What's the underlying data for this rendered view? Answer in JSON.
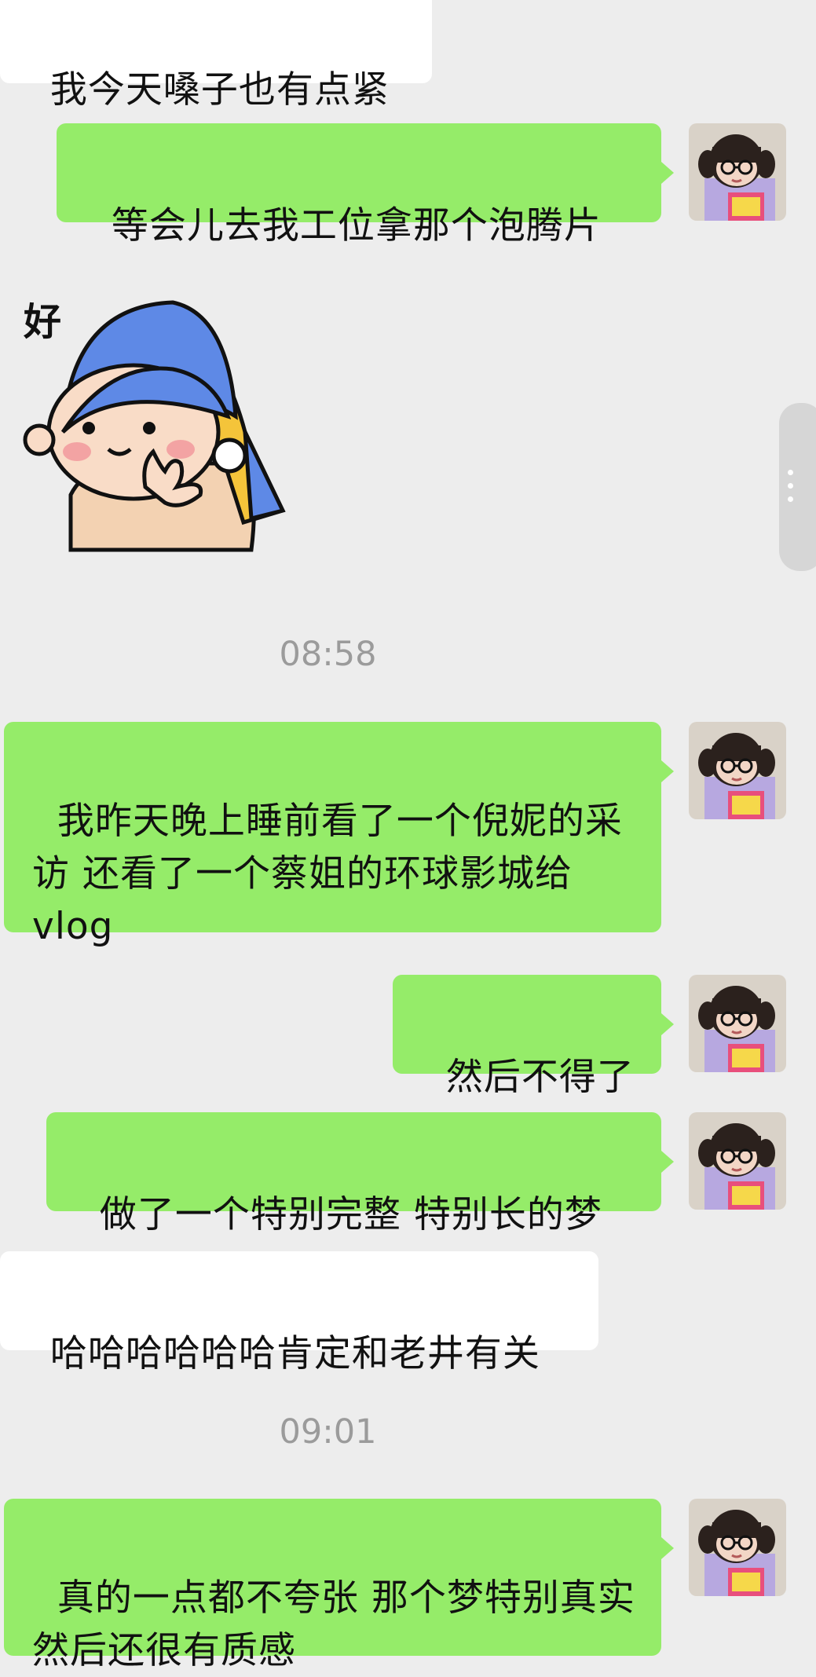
{
  "messages": [
    {
      "side": "left",
      "text": "我今天嗓子也有点紧"
    },
    {
      "side": "right",
      "text": "等会儿去我工位拿那个泡腾片"
    },
    {
      "side": "left",
      "sticker": "girl-with-pearl-earring-sticker",
      "text": "好"
    },
    {
      "type": "time",
      "text": "08:58"
    },
    {
      "side": "right",
      "text": "我昨天晚上睡前看了一个倪妮的采访 还看了一个蔡姐的环球影城给 vlog"
    },
    {
      "side": "right",
      "text": "然后不得了"
    },
    {
      "side": "right",
      "text": "做了一个特别完整 特别长的梦"
    },
    {
      "side": "left",
      "text": "哈哈哈哈哈哈肯定和老井有关"
    },
    {
      "type": "time",
      "text": "09:01"
    },
    {
      "side": "right",
      "text": "真的一点都不夸张 那个梦特别真实 然后还很有质感"
    }
  ],
  "colors": {
    "background": "#ededed",
    "self_bubble": "#95ec69",
    "other_bubble": "#ffffff",
    "time": "#9b9b9b"
  },
  "avatar_icon": "girl-with-glasses-avatar"
}
